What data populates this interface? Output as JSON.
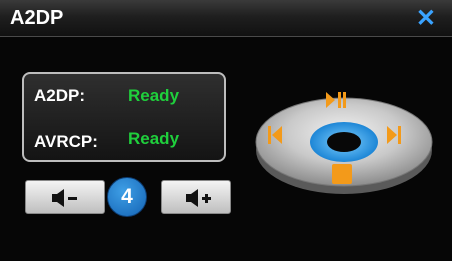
{
  "window": {
    "title": "A2DP"
  },
  "status": {
    "rows": [
      {
        "label": "A2DP:",
        "value": "Ready"
      },
      {
        "label": "AVRCP:",
        "value": "Ready"
      }
    ]
  },
  "volume": {
    "level": "4",
    "down_icon": "volume-down-icon",
    "up_icon": "volume-up-icon"
  },
  "player": {
    "controls": [
      "play-pause-icon",
      "previous-icon",
      "next-icon",
      "stop-icon"
    ]
  },
  "colors": {
    "accent_blue": "#3aa3ff",
    "ready_green": "#1fcf3c",
    "control_orange": "#f39a1a"
  }
}
